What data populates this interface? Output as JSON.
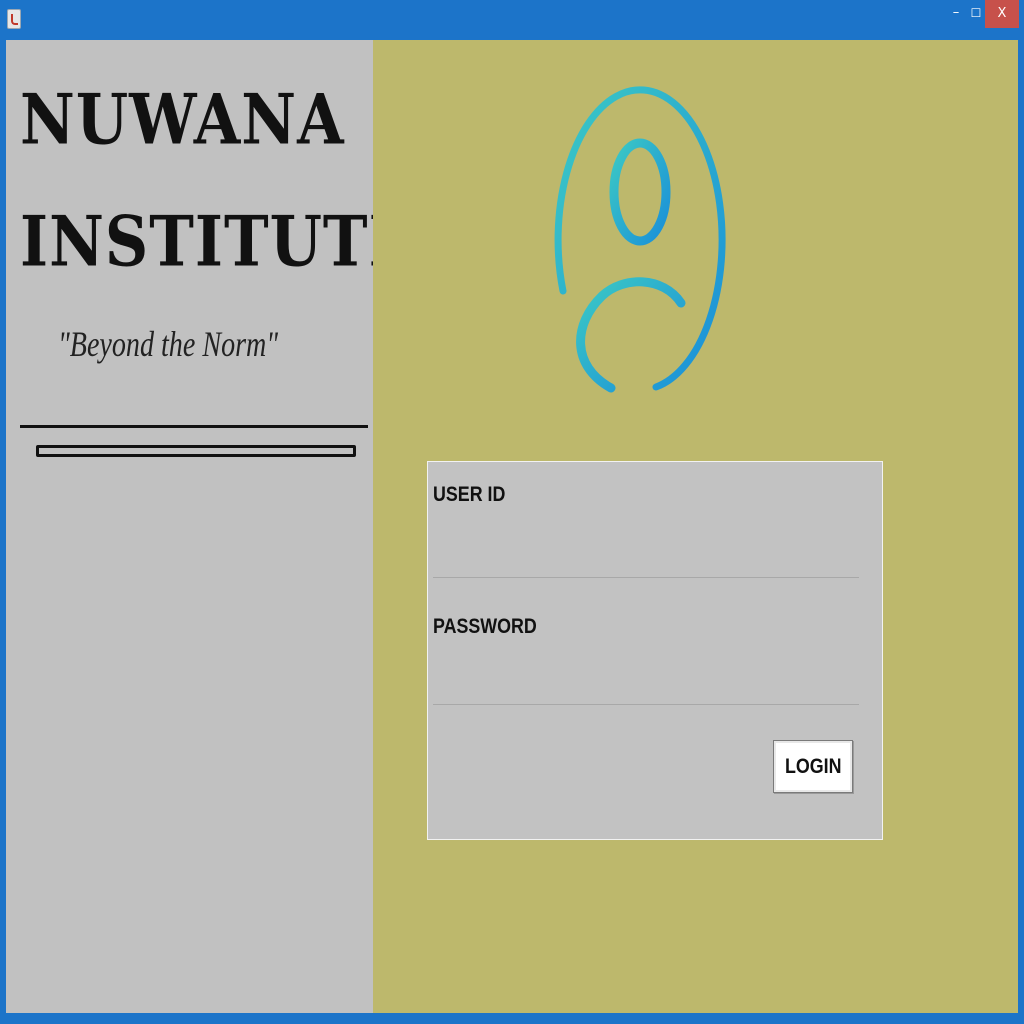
{
  "window": {
    "minimize_glyph": "–",
    "maximize_glyph": "☐",
    "close_label": "X"
  },
  "branding": {
    "title_line_1": "NUWANA",
    "title_line_2": "INSTITUTE",
    "tagline": "\"Beyond the Norm\""
  },
  "login": {
    "user_id_label": "USER ID",
    "user_id_value": "",
    "password_label": "PASSWORD",
    "password_value": "",
    "login_button_label": "LOGIN"
  },
  "icons": {
    "app": "java-app-icon",
    "avatar": "user-avatar-icon"
  },
  "colors": {
    "title_bar": "#1c74c9",
    "left_panel": "#c1c1c1",
    "right_panel": "#bdb86c",
    "card": "#c2c2c2",
    "avatar_gradient_start": "#3cc9c4",
    "avatar_gradient_end": "#1a8fd9",
    "close_button": "#c7514b"
  }
}
